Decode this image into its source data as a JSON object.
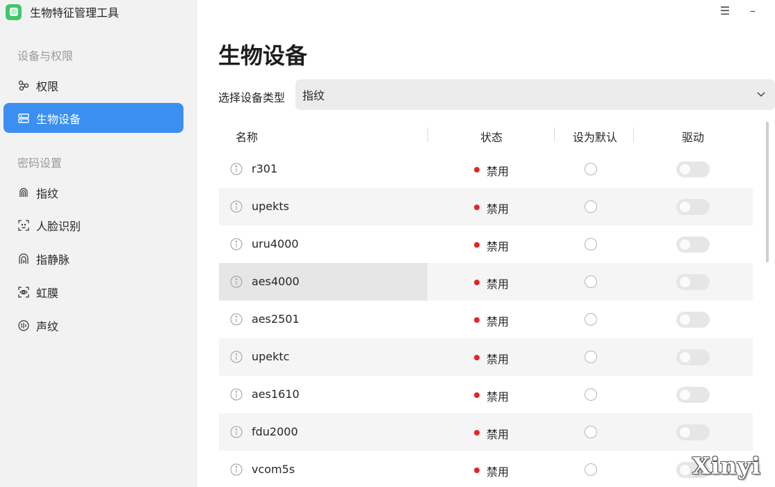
{
  "app": {
    "title": "生物特征管理工具"
  },
  "sidebar": {
    "sections": [
      {
        "title": "设备与权限"
      },
      {
        "title": "密码设置"
      }
    ],
    "items": [
      {
        "label": "权限",
        "icon": "permission-icon"
      },
      {
        "label": "生物设备",
        "icon": "device-list-icon",
        "active": true
      },
      {
        "label": "指纹",
        "icon": "fingerprint-icon"
      },
      {
        "label": "人脸识别",
        "icon": "face-scan-icon"
      },
      {
        "label": "指静脉",
        "icon": "finger-vein-icon"
      },
      {
        "label": "虹膜",
        "icon": "iris-eye-icon"
      },
      {
        "label": "声纹",
        "icon": "voiceprint-icon"
      }
    ]
  },
  "window": {
    "menu_glyph": "☰",
    "minimize_glyph": "–"
  },
  "main": {
    "title": "生物设备",
    "type_label": "选择设备类型",
    "type_value": "指纹",
    "columns": [
      "名称",
      "状态",
      "设为默认",
      "驱动"
    ],
    "devices": [
      {
        "name": "r301",
        "status": "禁用"
      },
      {
        "name": "upekts",
        "status": "禁用"
      },
      {
        "name": "uru4000",
        "status": "禁用"
      },
      {
        "name": "aes4000",
        "status": "禁用"
      },
      {
        "name": "aes2501",
        "status": "禁用"
      },
      {
        "name": "upektc",
        "status": "禁用"
      },
      {
        "name": "aes1610",
        "status": "禁用"
      },
      {
        "name": "fdu2000",
        "status": "禁用"
      },
      {
        "name": "vcom5s",
        "status": "禁用"
      }
    ]
  },
  "colors": {
    "accent": "#3b8ff1",
    "status_disabled": "#e3242b",
    "sidebar_bg": "#f2f2f2"
  },
  "watermark": "Xinyi"
}
